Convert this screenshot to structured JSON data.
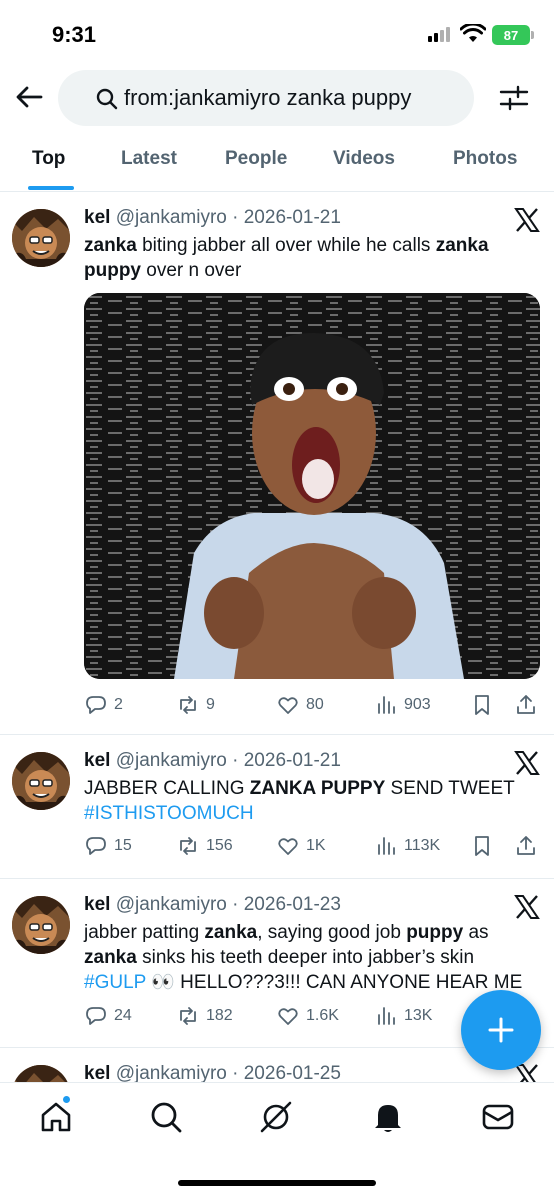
{
  "status": {
    "time": "9:31",
    "battery": "87"
  },
  "search": {
    "query": "from:jankamiyro zanka puppy"
  },
  "tabs": [
    "Top",
    "Latest",
    "People",
    "Videos",
    "Photos"
  ],
  "active_tab": "Top",
  "tweets": [
    {
      "name": "kel",
      "meta": "@jankamiyro · 2026-01-21",
      "body": [
        {
          "t": "zanka",
          "b": true
        },
        {
          "t": " biting jabber all over while he calls "
        },
        {
          "t": "zanka puppy",
          "b": true
        },
        {
          "t": " over n over"
        }
      ],
      "has_media": true,
      "stats": {
        "replies": "2",
        "reposts": "9",
        "likes": "80",
        "views": "903"
      }
    },
    {
      "name": "kel",
      "meta": "@jankamiyro · 2026-01-21",
      "body": [
        {
          "t": "JABBER CALLING "
        },
        {
          "t": "ZANKA PUPPY",
          "b": true
        },
        {
          "t": " SEND TWEET "
        },
        {
          "t": "#ISTHISTOOMUCH",
          "tag": true
        }
      ],
      "has_media": false,
      "stats": {
        "replies": "15",
        "reposts": "156",
        "likes": "1K",
        "views": "113K"
      }
    },
    {
      "name": "kel",
      "meta": "@jankamiyro · 2026-01-23",
      "body": [
        {
          "t": "jabber patting "
        },
        {
          "t": "zanka",
          "b": true
        },
        {
          "t": ", saying good job "
        },
        {
          "t": "puppy",
          "b": true
        },
        {
          "t": " as "
        },
        {
          "t": "zanka",
          "b": true
        },
        {
          "t": " sinks his teeth deeper into jabber’s skin "
        },
        {
          "t": "#GULP",
          "tag": true
        },
        {
          "t": " 👀 HELLO???3!!! CAN ANYONE HEAR ME"
        }
      ],
      "has_media": false,
      "stats": {
        "replies": "24",
        "reposts": "182",
        "likes": "1.6K",
        "views": "13K"
      }
    },
    {
      "name": "kel",
      "meta": "@jankamiyro · 2026-01-25",
      "body": [],
      "has_media": false,
      "stats": null
    }
  ],
  "colors": {
    "accent": "#1d9bf0",
    "text": "#0f1419",
    "muted": "#536471",
    "battery": "#34c759"
  },
  "icons": [
    "back-arrow-icon",
    "search-icon",
    "filter-icon",
    "x-logo-icon",
    "reply-icon",
    "repost-icon",
    "like-icon",
    "views-icon",
    "bookmark-icon",
    "share-icon",
    "compose-icon",
    "home-icon",
    "explore-icon",
    "grok-icon",
    "notifications-icon",
    "messages-icon"
  ]
}
